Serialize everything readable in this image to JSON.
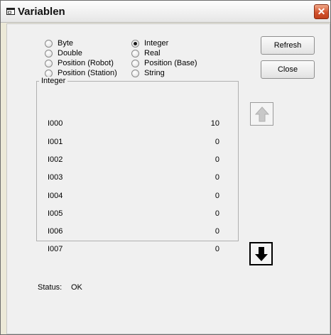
{
  "window": {
    "title": "Variablen"
  },
  "radios": [
    {
      "label": "Byte",
      "checked": false
    },
    {
      "label": "Double",
      "checked": false
    },
    {
      "label": "Position (Robot)",
      "checked": false
    },
    {
      "label": "Position (Station)",
      "checked": false
    },
    {
      "label": "Integer",
      "checked": true
    },
    {
      "label": "Real",
      "checked": false
    },
    {
      "label": "Position (Base)",
      "checked": false
    },
    {
      "label": "String",
      "checked": false
    }
  ],
  "buttons": {
    "refresh": "Refresh",
    "close": "Close"
  },
  "group": {
    "label": "Integer",
    "rows": [
      {
        "name": "I000",
        "value": "10"
      },
      {
        "name": "I001",
        "value": "0"
      },
      {
        "name": "I002",
        "value": "0"
      },
      {
        "name": "I003",
        "value": "0"
      },
      {
        "name": "I004",
        "value": "0"
      },
      {
        "name": "I005",
        "value": "0"
      },
      {
        "name": "I006",
        "value": "0"
      },
      {
        "name": "I007",
        "value": "0"
      }
    ]
  },
  "scroll": {
    "up_enabled": false,
    "down_enabled": true
  },
  "status": {
    "label": "Status:",
    "value": "OK"
  }
}
